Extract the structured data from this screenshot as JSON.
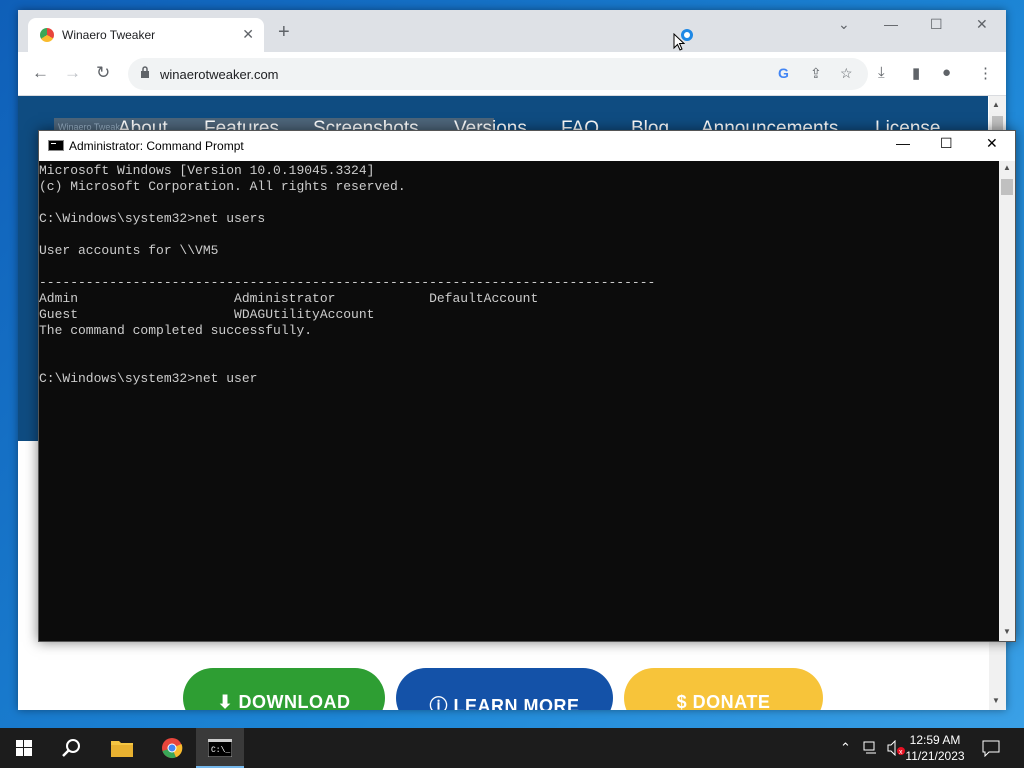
{
  "browser": {
    "tab_title": "Winaero Tweaker",
    "tab_close": "✕",
    "new_tab": "+",
    "url": "winaerotweaker.com"
  },
  "site": {
    "logo_text": "Winaero Tweak",
    "nav": [
      "About",
      "Features",
      "Screenshots",
      "Versions",
      "FAQ",
      "Blog",
      "Announcements",
      "License"
    ],
    "buttons": {
      "download": "⬇ DOWNLOAD",
      "learn": "ⓘ LEARN MORE",
      "donate": "$ DONATE"
    }
  },
  "cmd": {
    "title": "Administrator: Command Prompt",
    "lines": [
      "Microsoft Windows [Version 10.0.19045.3324]",
      "(c) Microsoft Corporation. All rights reserved.",
      "",
      "C:\\Windows\\system32>net users",
      "",
      "User accounts for \\\\VM5",
      "",
      "-------------------------------------------------------------------------------",
      "Admin                    Administrator            DefaultAccount",
      "Guest                    WDAGUtilityAccount",
      "The command completed successfully.",
      "",
      "",
      "C:\\Windows\\system32>net user"
    ]
  },
  "taskbar": {
    "time": "12:59 AM",
    "date": "11/21/2023"
  },
  "colors": {
    "desktop": "#1a78c8",
    "site_header": "#0f4c81",
    "download": "#2e9e33",
    "learn": "#1452a8",
    "donate": "#f7c43a",
    "console_bg": "#0c0c0c",
    "console_fg": "#cccccc"
  }
}
